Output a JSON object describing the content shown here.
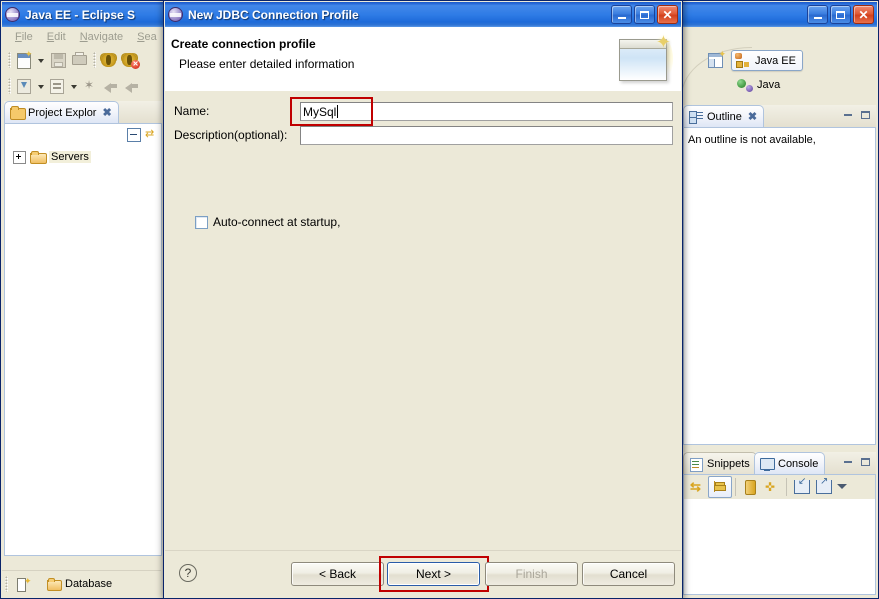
{
  "eclipse": {
    "title": "Java EE - Eclipse S",
    "icon": "eclipse-globe-icon",
    "window_buttons": {
      "minimize": "_",
      "maximize": "□",
      "close": "✕"
    },
    "menus": [
      {
        "label": "File",
        "mnemonic": "F"
      },
      {
        "label": "Edit",
        "mnemonic": "E"
      },
      {
        "label": "Navigate",
        "mnemonic": "N"
      },
      {
        "label": "Sea",
        "mnemonic": "S"
      }
    ],
    "toolbar_row1": [
      "new-wizard-icon",
      "new-dropdown-arrow-icon",
      "save-icon",
      "print-icon",
      "debug-icon",
      "terminate-debug-icon"
    ],
    "toolbar_row2": [
      "run-icon",
      "run-dropdown-arrow-icon",
      "external-tools-icon",
      "external-dropdown-arrow-icon",
      "search-icon",
      "back-navigation-icon",
      "forward-navigation-icon"
    ],
    "project_explorer": {
      "tab_label": "Project Explor",
      "tab_icon": "project-explorer-icon",
      "close_glyph": "✖",
      "toolbar": [
        "collapse-all-icon",
        "link-with-editor-icon"
      ],
      "tree": [
        {
          "label": "Servers",
          "expander": "+",
          "icon": "folder-icon",
          "selected": true
        }
      ]
    },
    "statusbar": {
      "editor_area_icon": "editor-area-icon",
      "text": "Database",
      "icon": "folder-icon"
    },
    "right_panel": {
      "perspective": {
        "open_perspective_icon": "open-perspective-icon",
        "items": [
          {
            "label": "Java EE",
            "icon": "java-ee-perspective-icon",
            "active": true
          },
          {
            "label": "Java",
            "icon": "java-perspective-icon",
            "active": false
          }
        ]
      },
      "outline": {
        "tab_label": "Outline",
        "tab_icon": "outline-icon",
        "close_glyph": "✖",
        "message": "An outline is not available,",
        "minimize_glyph": "—",
        "maximize_glyph": "□"
      },
      "console": {
        "tabs": [
          {
            "label": "Snippets",
            "icon": "snippets-icon",
            "active": false
          },
          {
            "label": "Console",
            "icon": "console-icon",
            "active": true
          }
        ],
        "minimize_glyph": "—",
        "maximize_glyph": "□",
        "toolbar": [
          "display-selected-console-icon",
          "show-console-view-icon",
          "scroll-lock-icon",
          "pin-console-icon",
          "open-console-icon",
          "new-console-view-icon",
          "view-menu-icon"
        ]
      }
    }
  },
  "dialog": {
    "title": "New JDBC Connection Profile",
    "icon": "eclipse-globe-icon",
    "window_buttons": {
      "minimize": "_",
      "maximize": "□",
      "close": "✕"
    },
    "header": {
      "title": "Create connection profile",
      "subtitle": "Please enter detailed information",
      "banner_icon": "wizard-banner-icon"
    },
    "form": {
      "name": {
        "label": "Name:",
        "value": "MySql",
        "placeholder": "",
        "highlighted": true
      },
      "description": {
        "label": "Description(optional):",
        "value": "",
        "placeholder": ""
      },
      "auto_connect": {
        "label": "Auto-connect at startup,",
        "checked": false
      }
    },
    "footer": {
      "help_glyph": "?",
      "buttons": [
        {
          "id": "back",
          "label": "< Back",
          "mnemonic": "B",
          "enabled": true,
          "default": false,
          "highlighted": false
        },
        {
          "id": "next",
          "label": "Next >",
          "mnemonic": "N",
          "enabled": true,
          "default": true,
          "highlighted": true
        },
        {
          "id": "finish",
          "label": "Finish",
          "mnemonic": "F",
          "enabled": false,
          "default": false,
          "highlighted": false
        },
        {
          "id": "cancel",
          "label": "Cancel",
          "mnemonic": "",
          "enabled": true,
          "default": false,
          "highlighted": false
        }
      ]
    }
  },
  "annotations": {
    "accent_color": "#c00000",
    "boxes": [
      "name-field-highlight",
      "next-button-highlight"
    ]
  }
}
